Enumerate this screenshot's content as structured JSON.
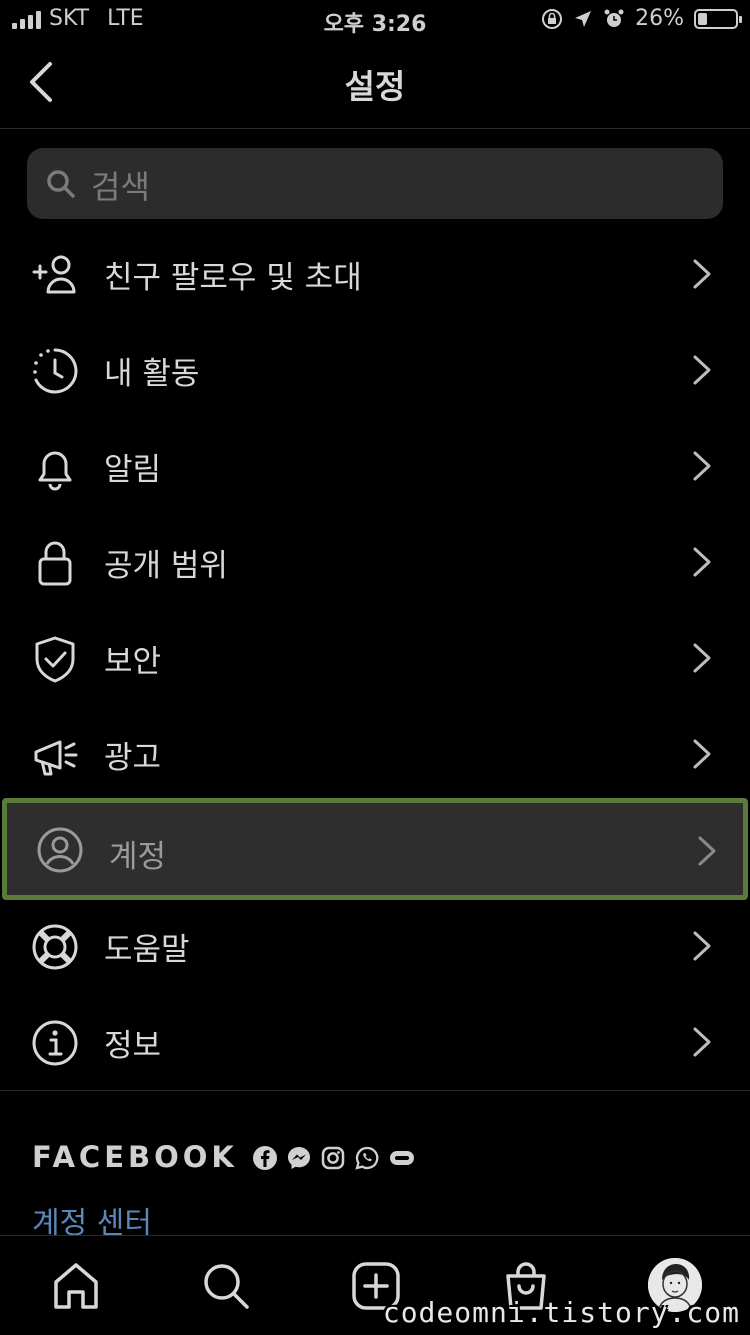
{
  "status_bar": {
    "carrier": "SKT",
    "network": "LTE",
    "time": "오후 3:26",
    "battery": "26%",
    "battery_level": 0.26
  },
  "header": {
    "title": "설정"
  },
  "search": {
    "placeholder": "검색"
  },
  "menu": {
    "items": [
      {
        "label": "친구 팔로우 및 초대",
        "icon": "add-person-icon"
      },
      {
        "label": "내 활동",
        "icon": "activity-clock-icon"
      },
      {
        "label": "알림",
        "icon": "bell-icon"
      },
      {
        "label": "공개 범위",
        "icon": "lock-icon"
      },
      {
        "label": "보안",
        "icon": "shield-check-icon"
      },
      {
        "label": "광고",
        "icon": "megaphone-icon"
      },
      {
        "label": "계정",
        "icon": "account-circle-icon",
        "selected": true
      },
      {
        "label": "도움말",
        "icon": "lifebuoy-icon"
      },
      {
        "label": "정보",
        "icon": "info-icon"
      }
    ]
  },
  "facebook": {
    "title": "FACEBOOK",
    "account_center": "계정 센터",
    "icons": [
      "facebook-icon",
      "messenger-icon",
      "instagram-icon",
      "whatsapp-icon",
      "portal-icon"
    ]
  },
  "tabbar": {
    "tabs": [
      "home-icon",
      "search-icon",
      "create-icon",
      "shop-icon",
      "profile-avatar"
    ]
  },
  "watermark": "codeomni.tistory.com",
  "colors": {
    "background": "#000000",
    "search_bg": "#2c2c2c",
    "selected_bg": "#2e2e2e",
    "selected_border": "#5b7b3a",
    "link": "#5b86b8"
  }
}
